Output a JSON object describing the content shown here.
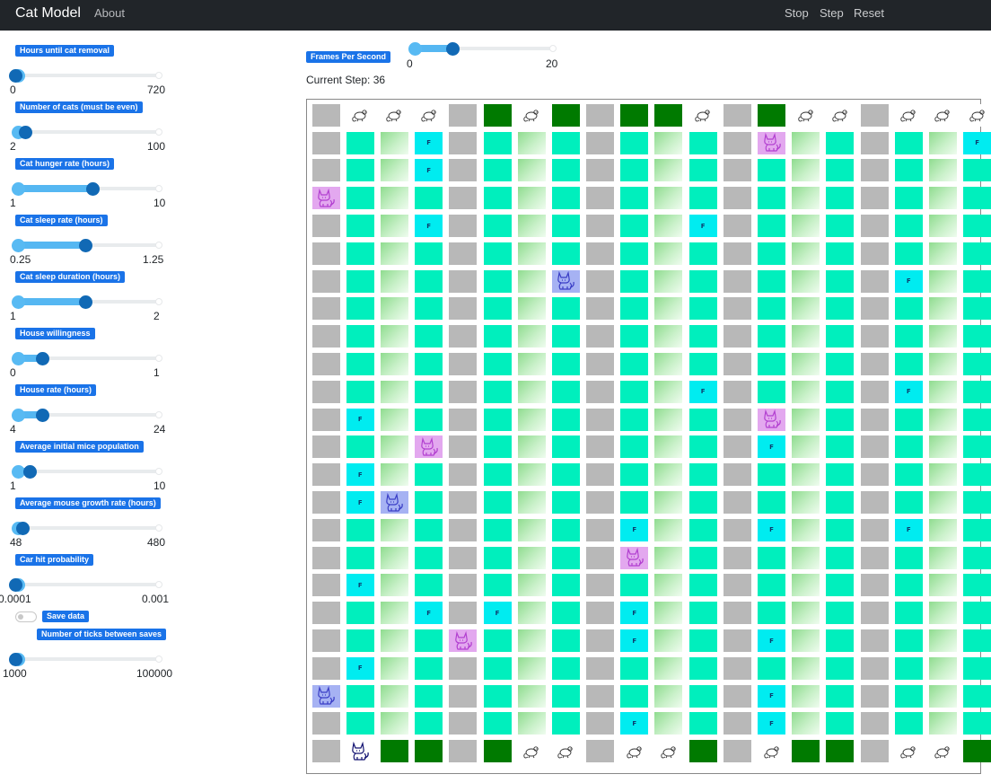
{
  "navbar": {
    "brand": "Cat Model",
    "about": "About",
    "stop": "Stop",
    "step": "Step",
    "reset": "Reset"
  },
  "params": [
    {
      "label": "Hours until cat removal",
      "min": "0",
      "max": "720",
      "value_fraction": 0.0
    },
    {
      "label": "Number of cats (must be even)",
      "min": "2",
      "max": "100",
      "value_fraction": 0.08
    },
    {
      "label": "Cat hunger rate (hours)",
      "min": "1",
      "max": "10",
      "value_fraction": 0.55
    },
    {
      "label": "Cat sleep rate (hours)",
      "min": "0.25",
      "max": "1.25",
      "value_fraction": 0.5
    },
    {
      "label": "Cat sleep duration (hours)",
      "min": "1",
      "max": "2",
      "value_fraction": 0.5
    },
    {
      "label": "House willingness",
      "min": "0",
      "max": "1",
      "value_fraction": 0.2
    },
    {
      "label": "House rate (hours)",
      "min": "4",
      "max": "24",
      "value_fraction": 0.2
    },
    {
      "label": "Average initial mice population",
      "min": "1",
      "max": "10",
      "value_fraction": 0.11
    },
    {
      "label": "Average mouse growth rate (hours)",
      "min": "48",
      "max": "480",
      "value_fraction": 0.06
    },
    {
      "label": "Car hit probability",
      "min": "0.0001",
      "max": "0.001",
      "value_fraction": 0.0
    },
    {
      "label": "Number of ticks between saves",
      "min": "1000",
      "max": "100000",
      "value_fraction": 0.0
    }
  ],
  "save_data": {
    "label": "Save data",
    "checked": false
  },
  "fps": {
    "label": "Frames Per Second",
    "min": "0",
    "max": "20",
    "value_fraction": 0.3
  },
  "status": {
    "prefix": "Current Step: ",
    "step": "36"
  },
  "grid": {
    "legend": {
      "R": "road",
      "G": "grass",
      "Y": "yard",
      "F": "food",
      "D": "dark-green",
      "M": "mouse",
      "C": "cat-pink",
      "B": "cat-blue",
      "K": "cat-dark"
    },
    "food_mark": "F",
    "rows": [
      "RMMMRDMDRDDMRDMMRMMM",
      "RGYFRGYGRGYGRCYGRGYF",
      "RGYFRGYGRGYGRGYGRGYG",
      "CGYGRGYGRGYGRGYGRGYG",
      "RGYFRGYGRGYFRGYGRGYG",
      "RGYGRGYGRGYGRGYGRGYG",
      "RGYGRGYBRGYGRGYGRFYG",
      "RGYGRGYGRGYGRGYGRGYG",
      "RGYGRGYGRGYGRGYGRGYG",
      "RGYGRGYGRGYGRGYGRGYG",
      "RGYGRGYGRGYFRGYGRFYG",
      "RFYGRGYGRGYGRCYGRGYG",
      "RGYCRGYGRGYGRFYGRGYG",
      "RFYGRGYGRGYGRGYGRGYG",
      "RFBGRGYGRGYGRGYGRGYG",
      "RGYGRGYGRFYGRFYGRFYG",
      "RGYGRGYGRCYGRGYGRGYG",
      "RFYGRGYGRGYGRGYGRGYG",
      "RGYFRFYGRFYGRGYGRGYG",
      "RGYGCGYGRFYGRFYGRGYG",
      "RFYGRGYGRGYGRGYGRGYG",
      "BGYGRGYGRGYGRFYGRGYG",
      "RGYGRGYGRFYGRFYGRGYG",
      "RKDDRDMMRMMDRMDDRMMD"
    ]
  }
}
